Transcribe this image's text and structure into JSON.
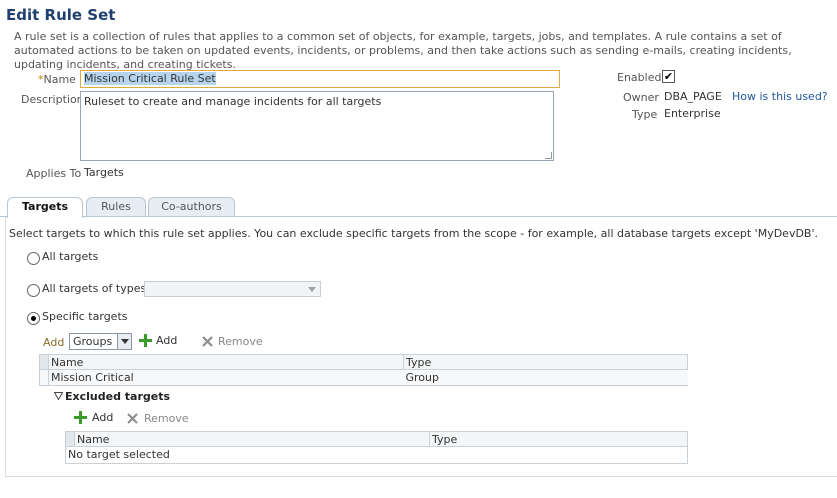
{
  "page": {
    "title": "Edit Rule Set",
    "description": "A rule set is a collection of rules that applies to a common set of objects, for example, targets, jobs, and templates. A rule contains a set of automated actions to be taken on updated events, incidents, or problems, and then take actions such as sending e-mails, creating incidents, updating incidents, and creating tickets."
  },
  "form": {
    "name_required_mark": "*",
    "name_label": "Name",
    "name_value": "Mission Critical Rule Set",
    "description_label": "Description",
    "description_value": "Ruleset to create and manage incidents for all targets",
    "applies_to_label": "Applies To",
    "applies_to_value": "Targets",
    "enabled_label": "Enabled",
    "enabled_checked": true,
    "enabled_mark": "✔",
    "owner_label": "Owner",
    "owner_value": "DBA_PAGE",
    "owner_help_link": "How is this used?",
    "type_label": "Type",
    "type_value": "Enterprise"
  },
  "tabs": [
    {
      "label": "Targets",
      "active": true
    },
    {
      "label": "Rules",
      "active": false
    },
    {
      "label": "Co-authors",
      "active": false
    }
  ],
  "targets_tab": {
    "instruction": "Select targets to which this rule set applies. You can exclude specific targets from the scope - for example, all database targets except 'MyDevDB'.",
    "options": {
      "all_targets": "All targets",
      "all_targets_of_types": "All targets of types",
      "specific_targets": "Specific targets"
    },
    "selected_option": "specific_targets",
    "add_label": "Add",
    "add_type_value": "Groups",
    "add_button": "Add",
    "remove_button": "Remove",
    "table": {
      "columns": [
        "Name",
        "Type"
      ],
      "rows": [
        {
          "name": "Mission Critical",
          "type": "Group"
        }
      ]
    },
    "excluded": {
      "title": "Excluded targets",
      "add_button": "Add",
      "remove_button": "Remove",
      "columns": [
        "Name",
        "Type"
      ],
      "empty_text": "No target selected"
    }
  },
  "colors": {
    "title": "#1f3f6f",
    "link": "#21579e",
    "field_focus_border": "#e3a943",
    "add_icon": "#3a9a2a"
  },
  "icons": {
    "add": "plus-icon",
    "remove": "x-icon",
    "collapse": "triangle-down-icon",
    "dropdown": "chevron-down-icon"
  }
}
